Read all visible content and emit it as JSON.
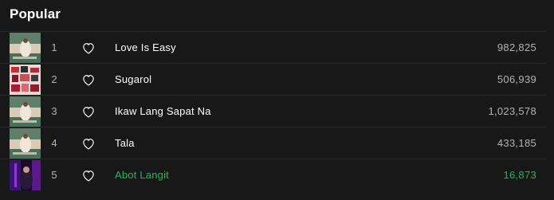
{
  "section": {
    "title": "Popular"
  },
  "tracks": [
    {
      "number": "1",
      "title": "Love Is Easy",
      "plays": "982,825",
      "cover": "album-a"
    },
    {
      "number": "2",
      "title": "Sugarol",
      "plays": "506,939",
      "cover": "album-b"
    },
    {
      "number": "3",
      "title": "Ikaw Lang Sapat Na",
      "plays": "1,023,578",
      "cover": "album-a"
    },
    {
      "number": "4",
      "title": "Tala",
      "plays": "433,185",
      "cover": "album-a"
    },
    {
      "number": "5",
      "title": "Abot Langit",
      "plays": "16,873",
      "cover": "album-c",
      "active": true
    }
  ],
  "colors": {
    "background": "#181818",
    "text": "#ffffff",
    "muted": "#b3b3b3",
    "accent": "#1db954",
    "divider": "#2a2a2a"
  }
}
